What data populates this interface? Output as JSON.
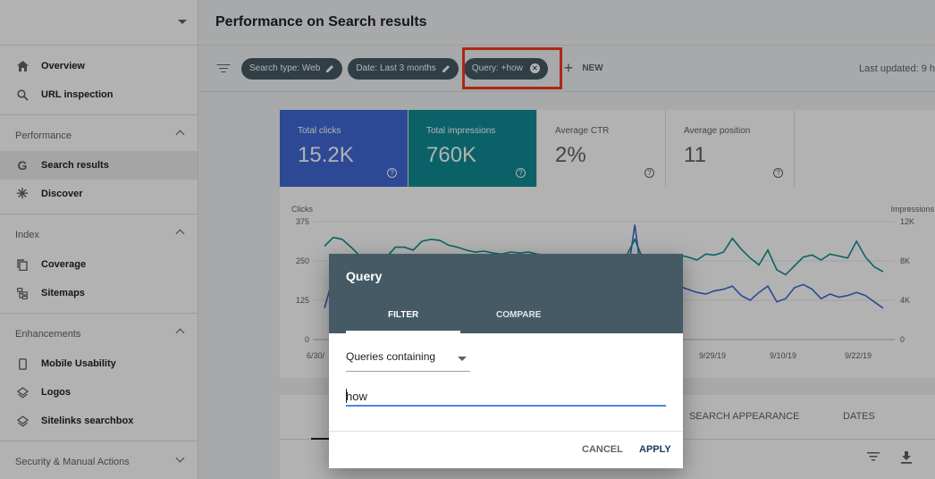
{
  "header": {
    "title": "Performance on Search results"
  },
  "sidebar": {
    "top_items": [
      {
        "label": "Overview",
        "icon": "home-icon"
      },
      {
        "label": "URL inspection",
        "icon": "search-icon"
      }
    ],
    "sections": [
      {
        "title": "Performance",
        "items": [
          {
            "label": "Search results",
            "icon": "google-g-icon"
          },
          {
            "label": "Discover",
            "icon": "asterisk-icon"
          }
        ]
      },
      {
        "title": "Index",
        "items": [
          {
            "label": "Coverage",
            "icon": "copy-pages-icon"
          },
          {
            "label": "Sitemaps",
            "icon": "sitemap-icon"
          }
        ]
      },
      {
        "title": "Enhancements",
        "items": [
          {
            "label": "Mobile Usability",
            "icon": "phone-icon"
          },
          {
            "label": "Logos",
            "icon": "layers-icon"
          },
          {
            "label": "Sitelinks searchbox",
            "icon": "layers-icon"
          }
        ]
      },
      {
        "title": "Security & Manual Actions",
        "items": []
      }
    ]
  },
  "filters": {
    "chips": [
      "Search type: Web",
      "Date: Last 3 months",
      "Query: +how"
    ],
    "new_label": "NEW",
    "last_updated": "Last updated: 9 h"
  },
  "metrics": [
    {
      "label": "Total clicks",
      "value": "15.2K"
    },
    {
      "label": "Total impressions",
      "value": "760K"
    },
    {
      "label": "Average CTR",
      "value": "2%"
    },
    {
      "label": "Average position",
      "value": "11"
    }
  ],
  "chart_data": {
    "type": "line",
    "left_axis_title": "Clicks",
    "right_axis_title": "Impressions",
    "left_ticks": [
      "375",
      "250",
      "125",
      "0"
    ],
    "right_ticks": [
      "12K",
      "8K",
      "4K",
      "0"
    ],
    "x_ticks": [
      "6/30/",
      "9/29/19",
      "9/10/19",
      "9/22/19"
    ],
    "ylim_left": [
      0,
      375
    ],
    "ylim_right": [
      0,
      12000
    ],
    "series": [
      {
        "color": "#4169d7",
        "values": [
          100,
          200,
          200,
          190,
          180,
          175,
          185,
          170,
          180,
          190,
          195,
          190,
          180,
          190,
          185,
          195,
          190,
          180,
          170,
          175,
          170,
          180,
          175,
          185,
          180,
          175,
          170,
          180,
          175,
          170,
          175,
          180,
          170,
          165,
          170,
          365,
          150,
          140,
          135,
          155,
          170,
          160,
          150,
          145,
          155,
          160,
          170,
          140,
          125,
          150,
          170,
          120,
          130,
          165,
          175,
          160,
          130,
          145,
          135,
          140,
          150,
          140,
          120,
          100
        ]
      },
      {
        "color": "#0f8d96",
        "values": [
          9500,
          10400,
          10200,
          9400,
          8500,
          7700,
          7600,
          8400,
          9400,
          9400,
          9100,
          10000,
          10200,
          10100,
          9600,
          9400,
          9100,
          8900,
          9000,
          8800,
          8700,
          8900,
          8800,
          8900,
          8700,
          8600,
          8400,
          8500,
          8400,
          8300,
          8300,
          8400,
          8300,
          8200,
          8400,
          10200,
          8000,
          7800,
          7600,
          7900,
          8600,
          8400,
          8100,
          8700,
          8600,
          8900,
          10300,
          9200,
          8300,
          7600,
          9100,
          7100,
          6600,
          7500,
          8400,
          8600,
          8100,
          8700,
          8500,
          8300,
          10000,
          8400,
          7400,
          6900
        ]
      }
    ]
  },
  "lower_tabs": [
    "SEARCH APPEARANCE",
    "DATES"
  ],
  "dialog": {
    "title": "Query",
    "tabs": [
      "FILTER",
      "COMPARE"
    ],
    "select_value": "Queries containing",
    "input_value": "how",
    "cancel_label": "CANCEL",
    "apply_label": "APPLY"
  }
}
